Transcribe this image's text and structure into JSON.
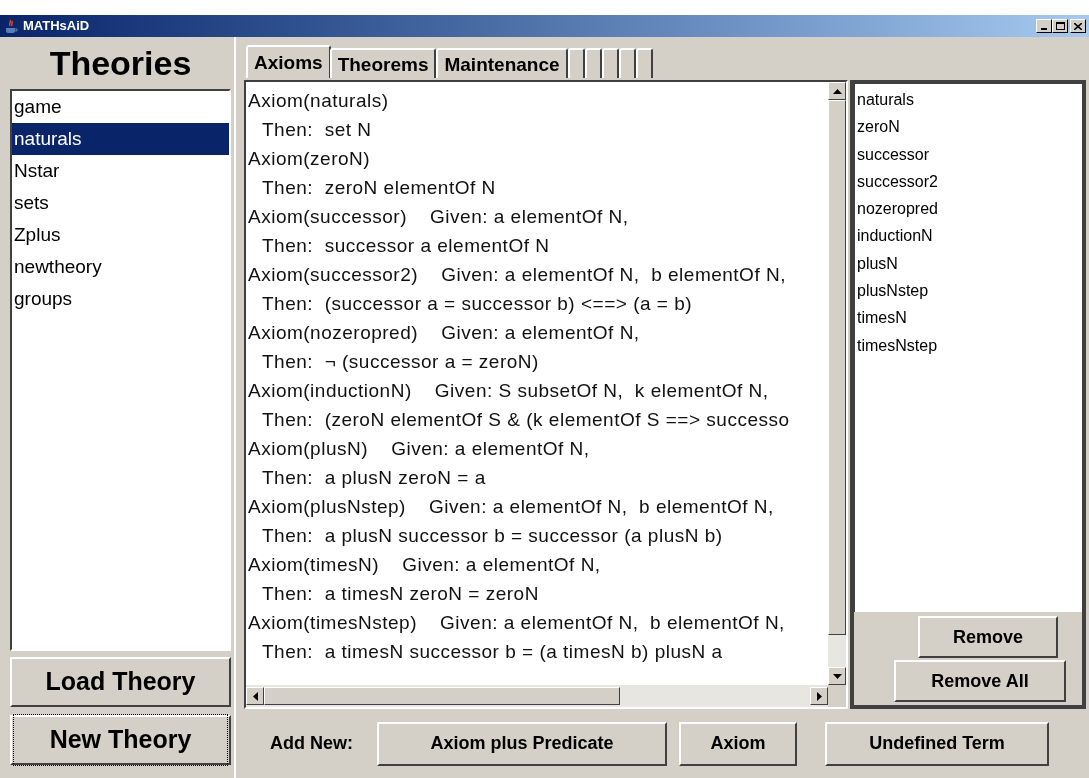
{
  "window": {
    "title": "MATHsAiD"
  },
  "theories": {
    "heading": "Theories",
    "items": [
      {
        "label": "game",
        "selected": false
      },
      {
        "label": "naturals",
        "selected": true
      },
      {
        "label": "Nstar",
        "selected": false
      },
      {
        "label": "sets",
        "selected": false
      },
      {
        "label": "Zplus",
        "selected": false
      },
      {
        "label": "newtheory",
        "selected": false
      },
      {
        "label": "groups",
        "selected": false
      }
    ],
    "buttons": [
      {
        "label": "Load Theory",
        "focused": false
      },
      {
        "label": "New Theory",
        "focused": true
      }
    ]
  },
  "tabs": [
    {
      "kind": "text",
      "label": "Axioms",
      "selected": true
    },
    {
      "kind": "text",
      "label": "Theorems",
      "selected": false
    },
    {
      "kind": "text",
      "label": "Maintenance",
      "selected": false
    },
    {
      "kind": "blank",
      "selected": false
    },
    {
      "kind": "blank",
      "selected": false
    },
    {
      "kind": "blank",
      "selected": false
    },
    {
      "kind": "blank",
      "selected": false
    },
    {
      "kind": "blank",
      "selected": false
    }
  ],
  "axioms": [
    {
      "head": "Axiom(naturals)",
      "then": "Then:  set N"
    },
    {
      "head": "Axiom(zeroN)",
      "then": "Then:  zeroN elementOf N"
    },
    {
      "head": "Axiom(successor)",
      "given": "Given: a elementOf N,",
      "then": "Then:  successor a elementOf N"
    },
    {
      "head": "Axiom(successor2)",
      "given": "Given: a elementOf N,  b elementOf N,",
      "then": "Then:  (successor a = successor b) <==> (a = b)"
    },
    {
      "head": "Axiom(nozeropred)",
      "given": "Given: a elementOf N,",
      "then": "Then:  ¬ (successor a = zeroN)"
    },
    {
      "head": "Axiom(inductionN)",
      "given": "Given: S subsetOf N,  k elementOf N,",
      "then": "Then:  (zeroN elementOf S & (k elementOf S ==> successo"
    },
    {
      "head": "Axiom(plusN)",
      "given": "Given: a elementOf N,",
      "then": "Then:  a plusN zeroN = a"
    },
    {
      "head": "Axiom(plusNstep)",
      "given": "Given: a elementOf N,  b elementOf N,",
      "then": "Then:  a plusN successor b = successor (a plusN b)"
    },
    {
      "head": "Axiom(timesN)",
      "given": "Given: a elementOf N,",
      "then": "Then:  a timesN zeroN = zeroN"
    },
    {
      "head": "Axiom(timesNstep)",
      "given": "Given: a elementOf N,  b elementOf N,",
      "then": "Then:  a timesN successor b = (a timesN b) plusN a"
    }
  ],
  "axiom_names": [
    "naturals",
    "zeroN",
    "successor",
    "successor2",
    "nozeropred",
    "inductionN",
    "plusN",
    "plusNstep",
    "timesN",
    "timesNstep"
  ],
  "side_buttons": [
    "Remove",
    "Remove All"
  ],
  "add_new": {
    "label": "Add New:",
    "buttons": [
      "Axiom plus Predicate",
      "Axiom",
      "Undefined Term"
    ]
  }
}
